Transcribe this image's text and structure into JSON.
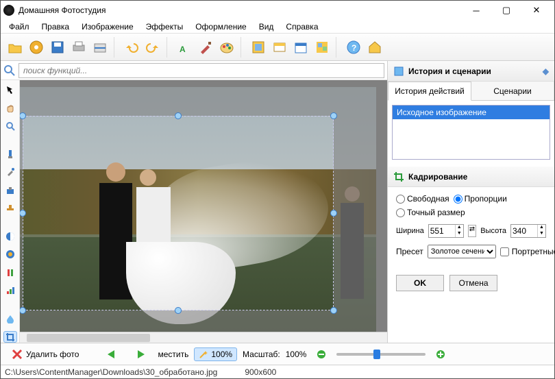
{
  "app": {
    "title": "Домашняя Фотостудия"
  },
  "menu": [
    "Файл",
    "Правка",
    "Изображение",
    "Эффекты",
    "Оформление",
    "Вид",
    "Справка"
  ],
  "search": {
    "placeholder": "поиск функций..."
  },
  "rightpanel": {
    "history_title": "История и сценарии",
    "tab_history": "История действий",
    "tab_scenarios": "Сценарии",
    "history_item": "Исходное изображение",
    "crop_title": "Кадрирование",
    "radio_free": "Свободная",
    "radio_prop": "Пропорции",
    "radio_exact": "Точный размер",
    "width_label": "Ширина",
    "height_label": "Высота",
    "width_value": "551",
    "height_value": "340",
    "preset_label": "Пресет",
    "preset_value": "Золотое сечение",
    "portrait_label": "Портретные",
    "ok": "OK",
    "cancel": "Отмена"
  },
  "bottombar": {
    "delete": "Удалить фото",
    "move": "местить",
    "zoom_fit": "100%",
    "scale_label": "Масштаб:",
    "scale_value": "100%"
  },
  "status": {
    "path": "C:\\Users\\ContentManager\\Downloads\\30_обработано.jpg",
    "dims": "900x600"
  }
}
